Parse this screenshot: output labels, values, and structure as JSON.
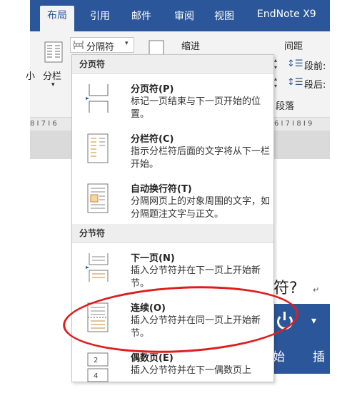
{
  "ribbon": {
    "tabs": [
      {
        "label": "布局",
        "active": true
      },
      {
        "label": "引用"
      },
      {
        "label": "邮件"
      },
      {
        "label": "审阅"
      },
      {
        "label": "视图"
      },
      {
        "label": "EndNote X9"
      }
    ],
    "breaks_button": "分隔符",
    "columns_label": "分栏",
    "small_label": "小",
    "indent_label": "缩进",
    "spacing_label": "间距",
    "space_before": "段前:",
    "space_after": "段后:",
    "paragraph_group": "段落",
    "ruler_left": "8 I 7 I 6",
    "ruler_right": "6 I 7 I 8 I 9"
  },
  "menu": {
    "page_breaks_header": "分页符",
    "section_breaks_header": "分节符",
    "items": [
      {
        "title": "分页符(P)",
        "desc": "标记一页结束与下一页开始的位置。"
      },
      {
        "title": "分栏符(C)",
        "desc": "指示分栏符后面的文字将从下一栏开始。"
      },
      {
        "title": "自动换行符(T)",
        "desc": "分隔网页上的对象周围的文字，如分隔题注文字与正文。"
      },
      {
        "title": "下一页(N)",
        "desc": "插入分节符并在下一页上开始新节。"
      },
      {
        "title": "连续(O)",
        "desc": "插入分节符并在同一页上开始新节。"
      },
      {
        "title": "偶数页(E)",
        "desc": "插入分节符并在下一偶数页上"
      }
    ]
  },
  "document": {
    "visible_text": "符?",
    "blue_panel_left": "始",
    "blue_panel_right": "插",
    "blue_panel_arrow": "▾"
  },
  "colors": {
    "ribbon_blue": "#2b579a",
    "annotation_red": "#e01d1d"
  }
}
